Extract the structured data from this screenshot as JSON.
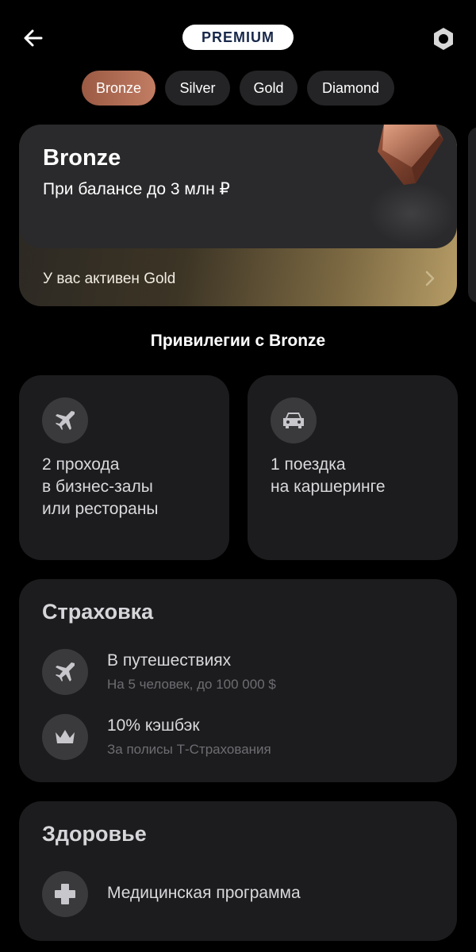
{
  "header": {
    "back_icon": "arrow-left-icon",
    "badge": "PREMIUM",
    "settings_icon": "hexagon-settings-icon"
  },
  "tabs": [
    {
      "label": "Bronze",
      "active": true
    },
    {
      "label": "Silver",
      "active": false
    },
    {
      "label": "Gold",
      "active": false
    },
    {
      "label": "Diamond",
      "active": false
    }
  ],
  "tier_card": {
    "title": "Bronze",
    "description": "При балансе до 3 млн ₽",
    "active_status": "У вас активен Gold",
    "chevron_icon": "chevron-right-icon",
    "gem_icon": "bronze-cube-icon"
  },
  "privileges": {
    "heading": "Привилегии с Bronze",
    "items": [
      {
        "icon": "airplane-icon",
        "lines": [
          "2 прохода",
          "в бизнес-залы",
          "или рестораны"
        ]
      },
      {
        "icon": "car-icon",
        "lines": [
          "1 поездка",
          "на каршеринге"
        ]
      }
    ]
  },
  "insurance": {
    "title": "Страховка",
    "rows": [
      {
        "icon": "airplane-icon",
        "title": "В путешествиях",
        "subtitle": "На 5 человек, до 100 000 $"
      },
      {
        "icon": "crown-icon",
        "title": "10% кэшбэк",
        "subtitle": "За полисы Т-Страхования"
      }
    ]
  },
  "health": {
    "title": "Здоровье",
    "rows": [
      {
        "icon": "medical-cross-icon",
        "title": "Медицинская программа"
      }
    ]
  },
  "colors": {
    "background": "#000000",
    "card": "#1c1c1e",
    "bronze_accent": "#b06b53",
    "gold_gradient": "#b69c66"
  }
}
